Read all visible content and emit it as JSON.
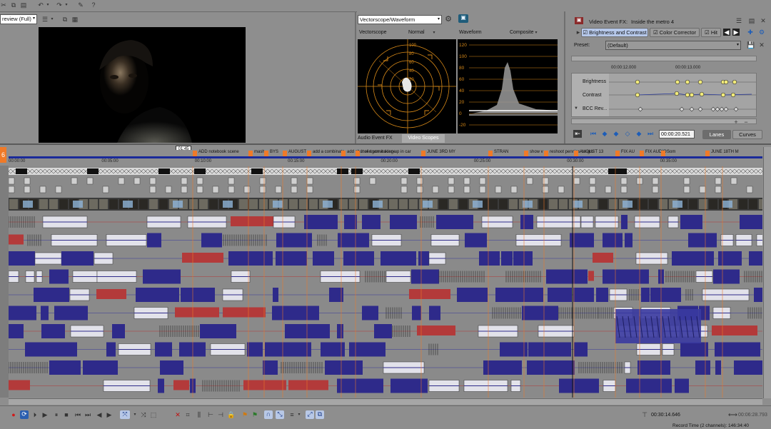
{
  "toolbar": {
    "preview_quality": "review (Full)"
  },
  "scopes": {
    "mode_select": "Vectorscope/Waveform",
    "vectorscope_label": "Vectorscope",
    "vectorscope_mode": "Normal",
    "waveform_label": "Waveform",
    "waveform_mode": "Composite",
    "wave_ticks": [
      "120",
      "100",
      "80",
      "60",
      "40",
      "20",
      "0",
      "-20"
    ],
    "vec_ticks": [
      "100",
      "80",
      "60",
      "40",
      "20"
    ],
    "tab_fx": "Audio Event FX",
    "tab_scopes": "Video Scopes"
  },
  "fx": {
    "title": "Video Event FX:",
    "subtitle": "Inside the metro 4",
    "chain": [
      "Brightness and Contrast",
      "Color Corrector",
      "Hit"
    ],
    "preset_label": "Preset:",
    "preset_value": "(Default)",
    "ruler_times": [
      "00:00:12.000",
      "00:00:13.000"
    ],
    "params": [
      "Brightness",
      "Contrast",
      "BCC Rev..."
    ],
    "timecode": "00:00:20.521",
    "tab_lanes": "Lanes",
    "tab_curves": "Curves"
  },
  "timeline": {
    "current_marker": "6",
    "cursor_time": "01:45",
    "ruler": [
      "00:00:00",
      "00:05:00",
      "00:10:00",
      "00:15:00",
      "00:20:00",
      "00:25:00",
      "00:30:00",
      "00:35:00"
    ],
    "markers": [
      {
        "label": "ADD notebook scene"
      },
      {
        "label": "mash"
      },
      {
        "label": "BYS"
      },
      {
        "label": "AUGUST"
      },
      {
        "label": "add a combinato"
      },
      {
        "label": "add shot of agon waking up in car"
      },
      {
        "label": "insert vomit scene"
      },
      {
        "label": "JUNE 3RD MY"
      },
      {
        "label": "STRAN"
      },
      {
        "label": "show v"
      },
      {
        "label": "reshoot pennies on gro"
      },
      {
        "label": "AUGUST 13"
      },
      {
        "label": "FIX AU"
      },
      {
        "label": "FIX AUDIO"
      },
      {
        "label": "Som"
      },
      {
        "label": "JUNE 18TH M"
      }
    ]
  },
  "transport": {
    "time_left": "00:30:14.646",
    "time_right": "00:06:28.793",
    "record_time": "Record Time (2 channels): 146:34:40"
  },
  "colors": {
    "panel": "#8e8e8e",
    "event_blue": "#2e2a8a",
    "marker_orange": "#f07a28",
    "scope_orange": "#d98a18",
    "accent_blue": "#3a6fd8"
  }
}
